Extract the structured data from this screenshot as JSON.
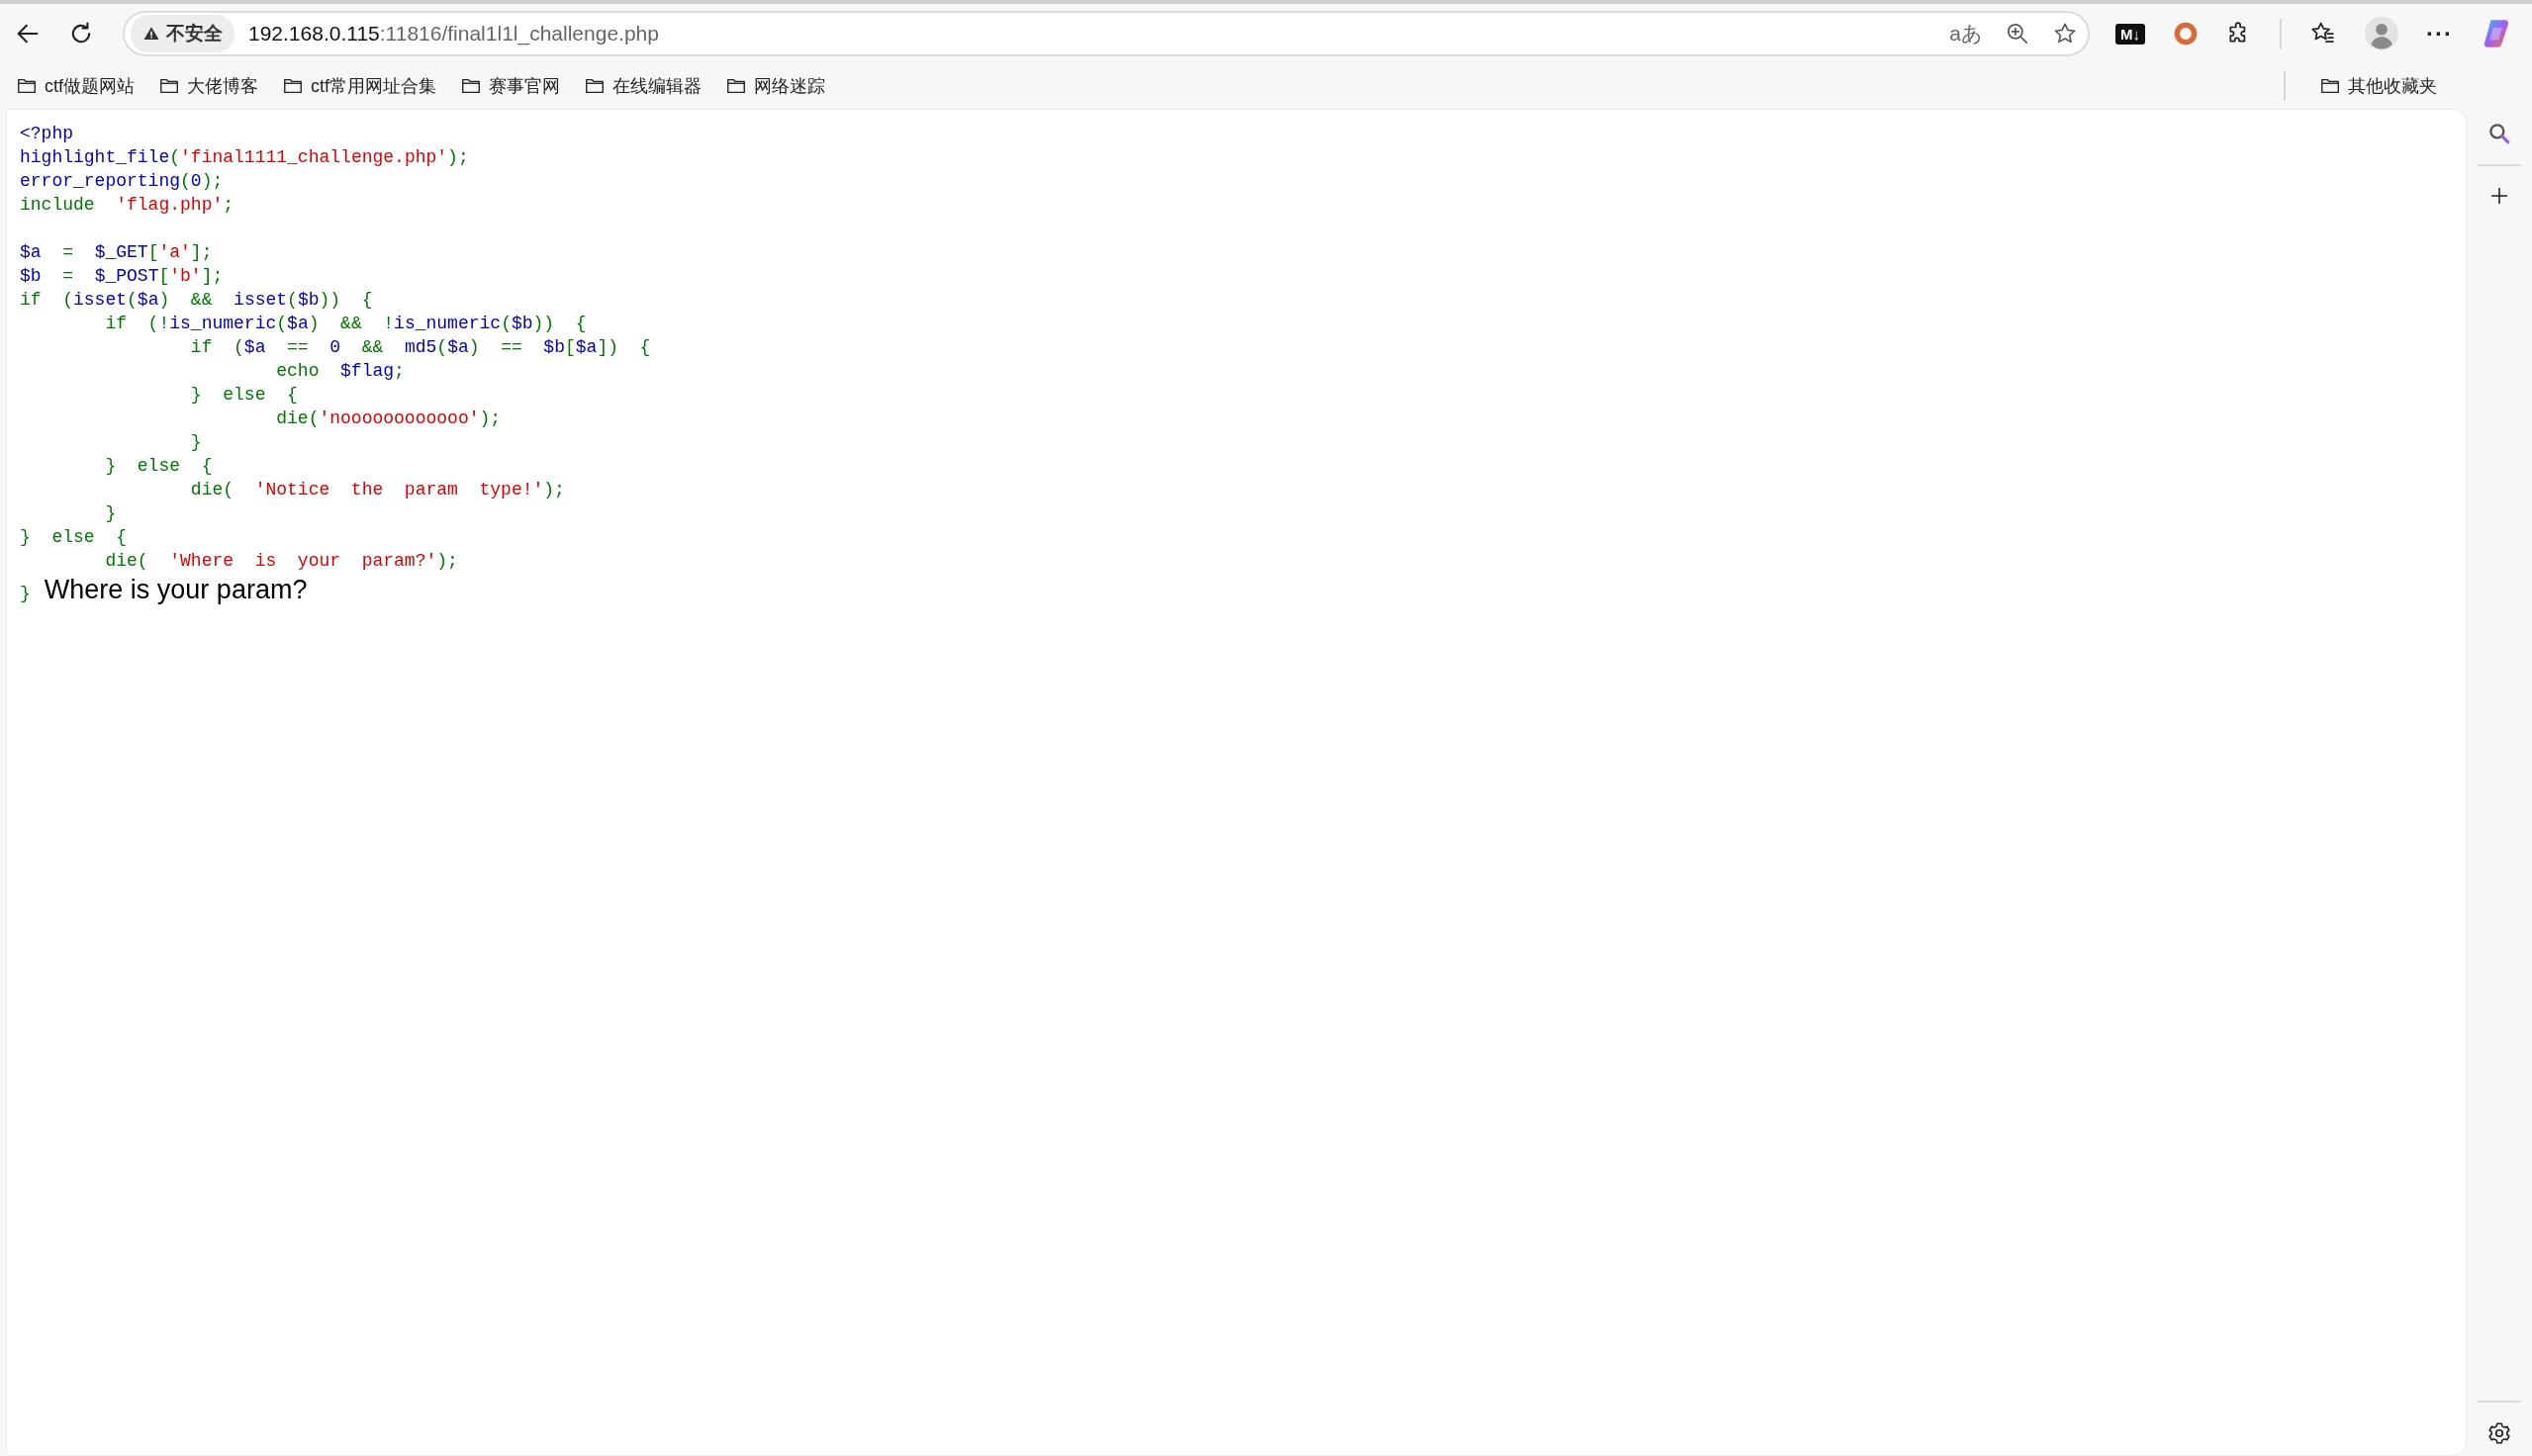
{
  "toolbar": {
    "security_label": "不安全",
    "url_host": "192.168.0.115",
    "url_rest": ":11816/final1l1l_challenge.php",
    "translate_glyph": "aあ",
    "markdown_badge": "M↓",
    "more_glyph": "···"
  },
  "bookmarks": [
    {
      "label": "ctf做题网站"
    },
    {
      "label": "大佬博客"
    },
    {
      "label": "ctf常用网址合集"
    },
    {
      "label": "赛事官网"
    },
    {
      "label": "在线编辑器"
    },
    {
      "label": "网络迷踪"
    }
  ],
  "other_bookmarks": "其他收藏夹",
  "code_lines": [
    {
      "kind": "code",
      "tokens": [
        {
          "kind": "default",
          "text": "<?php"
        }
      ]
    },
    {
      "kind": "code",
      "tokens": [
        {
          "kind": "default",
          "text": "highlight_file"
        },
        {
          "kind": "keyword",
          "text": "("
        },
        {
          "kind": "string",
          "text": "'final1111_challenge.php'"
        },
        {
          "kind": "keyword",
          "text": ");"
        }
      ]
    },
    {
      "kind": "code",
      "tokens": [
        {
          "kind": "default",
          "text": "error_reporting"
        },
        {
          "kind": "keyword",
          "text": "("
        },
        {
          "kind": "default",
          "text": "0"
        },
        {
          "kind": "keyword",
          "text": ");"
        }
      ]
    },
    {
      "kind": "code",
      "tokens": [
        {
          "kind": "keyword",
          "text": "include  "
        },
        {
          "kind": "string",
          "text": "'flag.php'"
        },
        {
          "kind": "keyword",
          "text": ";"
        }
      ]
    },
    {
      "kind": "blank"
    },
    {
      "kind": "code",
      "tokens": [
        {
          "kind": "default",
          "text": "$a  "
        },
        {
          "kind": "keyword",
          "text": "=  "
        },
        {
          "kind": "default",
          "text": "$_GET"
        },
        {
          "kind": "keyword",
          "text": "["
        },
        {
          "kind": "string",
          "text": "'a'"
        },
        {
          "kind": "keyword",
          "text": "];"
        }
      ]
    },
    {
      "kind": "code",
      "tokens": [
        {
          "kind": "default",
          "text": "$b  "
        },
        {
          "kind": "keyword",
          "text": "=  "
        },
        {
          "kind": "default",
          "text": "$_POST"
        },
        {
          "kind": "keyword",
          "text": "["
        },
        {
          "kind": "string",
          "text": "'b'"
        },
        {
          "kind": "keyword",
          "text": "];"
        }
      ]
    },
    {
      "kind": "code",
      "tokens": [
        {
          "kind": "keyword",
          "text": "if  ("
        },
        {
          "kind": "default",
          "text": "isset"
        },
        {
          "kind": "keyword",
          "text": "("
        },
        {
          "kind": "default",
          "text": "$a"
        },
        {
          "kind": "keyword",
          "text": ")  &&  "
        },
        {
          "kind": "default",
          "text": "isset"
        },
        {
          "kind": "keyword",
          "text": "("
        },
        {
          "kind": "default",
          "text": "$b"
        },
        {
          "kind": "keyword",
          "text": "))  {"
        }
      ]
    },
    {
      "kind": "code",
      "tokens": [
        {
          "kind": "keyword",
          "text": "        if  (!"
        },
        {
          "kind": "default",
          "text": "is_numeric"
        },
        {
          "kind": "keyword",
          "text": "("
        },
        {
          "kind": "default",
          "text": "$a"
        },
        {
          "kind": "keyword",
          "text": ")  &&  !"
        },
        {
          "kind": "default",
          "text": "is_numeric"
        },
        {
          "kind": "keyword",
          "text": "("
        },
        {
          "kind": "default",
          "text": "$b"
        },
        {
          "kind": "keyword",
          "text": "))  {"
        }
      ]
    },
    {
      "kind": "code",
      "tokens": [
        {
          "kind": "keyword",
          "text": "                if  ("
        },
        {
          "kind": "default",
          "text": "$a  "
        },
        {
          "kind": "keyword",
          "text": "==  "
        },
        {
          "kind": "default",
          "text": "0  "
        },
        {
          "kind": "keyword",
          "text": "&&  "
        },
        {
          "kind": "default",
          "text": "md5"
        },
        {
          "kind": "keyword",
          "text": "("
        },
        {
          "kind": "default",
          "text": "$a"
        },
        {
          "kind": "keyword",
          "text": ")  ==  "
        },
        {
          "kind": "default",
          "text": "$b"
        },
        {
          "kind": "keyword",
          "text": "["
        },
        {
          "kind": "default",
          "text": "$a"
        },
        {
          "kind": "keyword",
          "text": "])  {"
        }
      ]
    },
    {
      "kind": "code",
      "tokens": [
        {
          "kind": "keyword",
          "text": "                        echo  "
        },
        {
          "kind": "default",
          "text": "$flag"
        },
        {
          "kind": "keyword",
          "text": ";"
        }
      ]
    },
    {
      "kind": "code",
      "tokens": [
        {
          "kind": "keyword",
          "text": "                }  else  {"
        }
      ]
    },
    {
      "kind": "code",
      "tokens": [
        {
          "kind": "keyword",
          "text": "                        die("
        },
        {
          "kind": "string",
          "text": "'noooooooooooo'"
        },
        {
          "kind": "keyword",
          "text": ");"
        }
      ]
    },
    {
      "kind": "code",
      "tokens": [
        {
          "kind": "keyword",
          "text": "                }"
        }
      ]
    },
    {
      "kind": "code",
      "tokens": [
        {
          "kind": "keyword",
          "text": "        }  else  {"
        }
      ]
    },
    {
      "kind": "code",
      "tokens": [
        {
          "kind": "keyword",
          "text": "                die(  "
        },
        {
          "kind": "string",
          "text": "'Notice  the  param  type!'"
        },
        {
          "kind": "keyword",
          "text": ");"
        }
      ]
    },
    {
      "kind": "code",
      "tokens": [
        {
          "kind": "keyword",
          "text": "        }"
        }
      ]
    },
    {
      "kind": "code",
      "tokens": [
        {
          "kind": "keyword",
          "text": "}  else  {"
        }
      ]
    },
    {
      "kind": "code",
      "tokens": [
        {
          "kind": "keyword",
          "text": "        die(  "
        },
        {
          "kind": "string",
          "text": "'Where  is  your  param?'"
        },
        {
          "kind": "keyword",
          "text": ");"
        }
      ]
    }
  ],
  "last_line": {
    "code": "}",
    "output": "Where is your param?"
  }
}
